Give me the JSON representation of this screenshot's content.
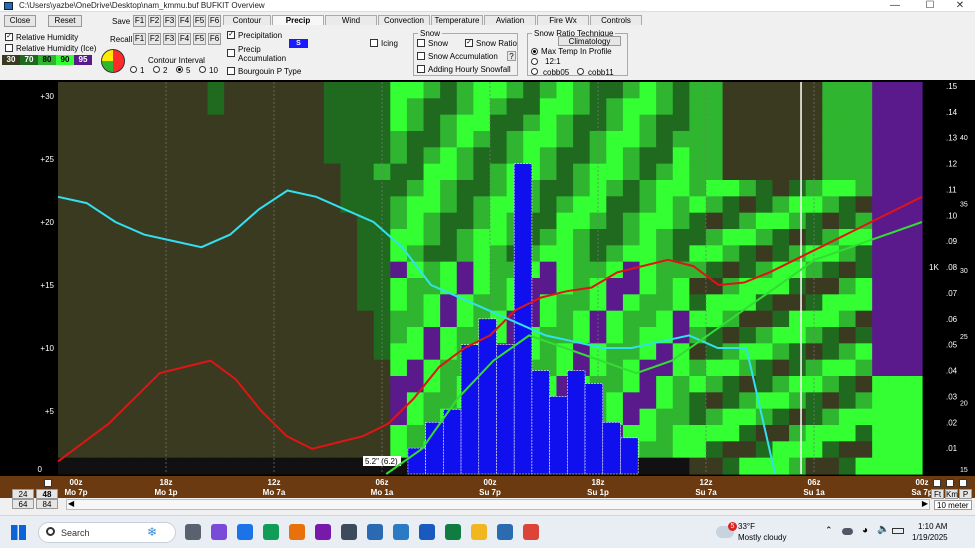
{
  "window": {
    "title": "C:\\Users\\yazbe\\OneDrive\\Desktop\\nam_kmmu.buf BUFKIT Overview",
    "minimize": "—",
    "maximize": "☐",
    "close": "✕"
  },
  "toolbar": {
    "close_label": "Close",
    "reset_label": "Reset",
    "save_label": "Save",
    "recall_label": "Recall",
    "fkeys": [
      "F1",
      "F2",
      "F3",
      "F4",
      "F5",
      "F6"
    ],
    "rh_label": "Relative Humidity",
    "rh_ice_label": "Relative Humidity (Ice)",
    "rh_checked": "✓",
    "legend": [
      {
        "label": "30",
        "color": "#3a3a20"
      },
      {
        "label": "70",
        "color": "#1f6a1f"
      },
      {
        "label": "80",
        "color": "#2fb52f"
      },
      {
        "label": "90",
        "color": "#33ff33"
      },
      {
        "label": "95",
        "color": "#5a1a8c"
      }
    ],
    "contour_interval_label": "Contour Interval",
    "contour_options": [
      "1",
      "2",
      "5",
      "10"
    ],
    "contour_selected": "5"
  },
  "tabs": [
    "Contour",
    "Precip",
    "Wind",
    "Convection",
    "Temperature",
    "Aviation",
    "Fire Wx",
    "Controls"
  ],
  "active_tab": "Precip",
  "precip_panel": {
    "precipitation_label": "Precipitation",
    "precipitation_checked": "✓",
    "precip_badge": "S",
    "precip_accum_label": "Precip\nAccumulation",
    "bourgouin_label": "Bourgouin P Type",
    "icing_label": "Icing"
  },
  "snow_panel": {
    "title": "Snow",
    "snow_label": "Snow",
    "snow_ratio_label": "Snow Ratio",
    "snow_ratio_checked": "✓",
    "snow_accum_label": "Snow Accumulation",
    "help_label": "?",
    "hourly_snowfall_label": "Adding Hourly Snowfall"
  },
  "technique_panel": {
    "title": "Snow Ratio Technique",
    "climatology_label": "Climatology",
    "max_temp_label": "Max Temp In Profile",
    "ratio_121_label": "12:1",
    "cobb05_label": "cobb05",
    "cobb11_label": "cobb11"
  },
  "chart_data": {
    "type": "bar",
    "title": "",
    "left_axis_ticks": [
      "+5",
      "+10",
      "+15",
      "+20",
      "+25",
      "+30"
    ],
    "left_zero": "0",
    "right_axis_ticks": [
      ".01",
      ".02",
      ".03",
      ".04",
      ".05",
      ".06",
      ".07",
      ".08",
      ".09",
      ".10",
      ".11",
      ".12",
      ".13",
      ".14",
      ".15"
    ],
    "far_right_ticks": [
      "15",
      "20",
      "25",
      "30",
      "35",
      "40"
    ],
    "right_unit": "1K",
    "time_labels": [
      {
        "z": "00z",
        "local": "Mo 7p"
      },
      {
        "z": "18z",
        "local": "Mo 1p"
      },
      {
        "z": "12z",
        "local": "Mo 7a"
      },
      {
        "z": "06z",
        "local": "Mo 1a"
      },
      {
        "z": "00z",
        "local": "Su 7p"
      },
      {
        "z": "18z",
        "local": "Su 1p"
      },
      {
        "z": "12z",
        "local": "Su 7a"
      },
      {
        "z": "06z",
        "local": "Su 1a"
      },
      {
        "z": "00z",
        "local": "Sa 7p"
      }
    ],
    "precip_bars": [
      0.01,
      0.02,
      0.025,
      0.05,
      0.06,
      0.05,
      0.12,
      0.04,
      0.03,
      0.04,
      0.035,
      0.02,
      0.014
    ],
    "snow_total_label": "5.2\" (6.2)",
    "red_line": [
      1,
      2.5,
      4,
      6,
      8,
      8.5,
      9,
      7.5,
      5,
      3,
      2,
      2.5,
      3,
      4,
      6,
      8.5,
      10,
      11,
      13,
      14,
      14.5,
      14.8,
      16,
      16.5,
      17,
      16.5,
      15,
      15.2,
      16,
      17,
      18,
      19,
      20,
      21,
      22
    ],
    "cyan_line": [
      22,
      21.5,
      20,
      19,
      18.5,
      18,
      19,
      21,
      22.5,
      22,
      21,
      20,
      18,
      15,
      14,
      13,
      12,
      11,
      10.5,
      10,
      10,
      10.5,
      11,
      10,
      10,
      0
    ],
    "green_line": [
      0,
      2,
      6,
      9,
      11,
      10,
      9,
      8,
      9,
      11,
      13,
      15,
      17,
      18,
      19,
      20
    ]
  },
  "bottom": {
    "hours": [
      "24",
      "48",
      "64",
      "84"
    ],
    "unit_buttons": [
      "Ft",
      "Km",
      "P"
    ],
    "wind_label": "10 meter"
  },
  "taskbar": {
    "search_placeholder": "Search",
    "weather_temp": "33°F",
    "weather_desc": "Mostly cloudy",
    "weather_badge": "5",
    "time": "1:10 AM",
    "date": "1/19/2025"
  }
}
